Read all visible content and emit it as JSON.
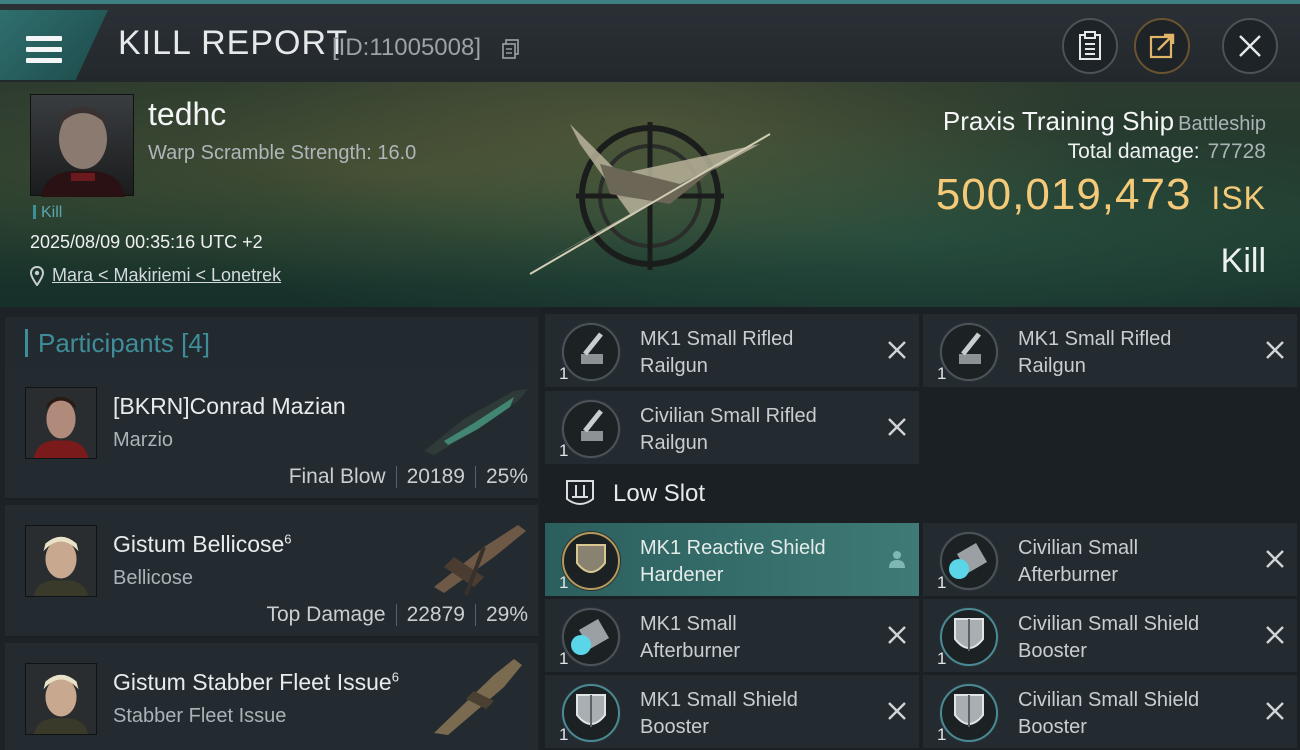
{
  "header": {
    "title": "KILL REPORT",
    "report_id": "[ID:11005008]",
    "icons": [
      "menu-icon",
      "copy-icon",
      "clipboard-icon",
      "share-icon",
      "close-icon"
    ]
  },
  "victim": {
    "name": "tedhc",
    "warp_scramble": "Warp Scramble Strength: 16.0",
    "tag": "Kill",
    "datetime": "2025/08/09 00:35:16 UTC +2",
    "location": "Mara < Makiriemi < Lonetrek",
    "ship_name": "Praxis Training Ship",
    "ship_class": "Battleship",
    "total_damage_label": "Total damage:",
    "total_damage": "77728",
    "isk_value": "500,019,473",
    "isk_unit": "ISK",
    "result": "Kill"
  },
  "participants": {
    "label": "Participants [4]",
    "items": [
      {
        "name": "[BKRN]Conrad Mazian",
        "sup": "",
        "ship": "Marzio",
        "role": "Final Blow",
        "damage": "20189",
        "pct": "25%"
      },
      {
        "name": "Gistum Bellicose",
        "sup": "6",
        "ship": "Bellicose",
        "role": "Top Damage",
        "damage": "22879",
        "pct": "29%"
      },
      {
        "name": "Gistum Stabber Fleet Issue",
        "sup": "6",
        "ship": "Stabber Fleet Issue",
        "role": "",
        "damage": "",
        "pct": ""
      }
    ]
  },
  "modules": {
    "high": [
      {
        "qty": "1",
        "line1": "MK1 Small Rifled",
        "line2": "Railgun",
        "icon": "railgun-icon"
      },
      {
        "qty": "1",
        "line1": "MK1 Small Rifled",
        "line2": "Railgun",
        "icon": "railgun-icon"
      },
      {
        "qty": "1",
        "line1": "Civilian Small Rifled",
        "line2": "Railgun",
        "icon": "railgun-icon"
      }
    ],
    "low_slot_label": "Low Slot",
    "low": [
      {
        "qty": "1",
        "line1": "MK1 Reactive Shield",
        "line2": "Hardener",
        "icon": "shield-hardener-icon"
      },
      {
        "qty": "1",
        "line1": "Civilian Small",
        "line2": "Afterburner",
        "icon": "afterburner-icon"
      },
      {
        "qty": "1",
        "line1": "MK1 Small",
        "line2": "Afterburner",
        "icon": "afterburner-icon"
      },
      {
        "qty": "1",
        "line1": "Civilian Small Shield",
        "line2": "Booster",
        "icon": "shield-booster-icon"
      },
      {
        "qty": "1",
        "line1": "MK1 Small Shield",
        "line2": "Booster",
        "icon": "shield-booster-icon"
      },
      {
        "qty": "1",
        "line1": "Civilian Small Shield",
        "line2": "Booster",
        "icon": "shield-booster-icon"
      }
    ]
  },
  "colors": {
    "accent": "#3f8d98",
    "isk": "#f4c978",
    "active_row": "#3f7a76"
  }
}
